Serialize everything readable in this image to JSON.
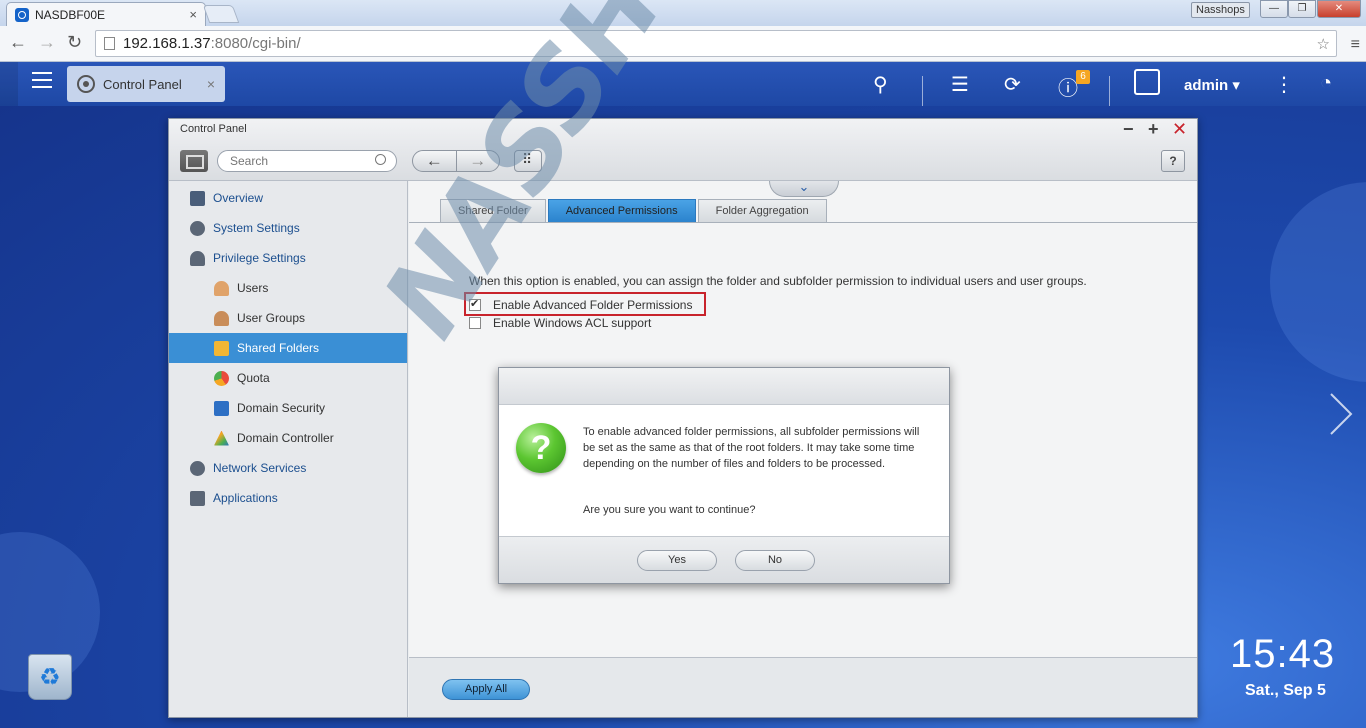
{
  "browser": {
    "tab_title": "NASDBF00E",
    "tab_close": "×",
    "profile": "Nasshops",
    "url_host": "192.168.1.37",
    "url_rest": ":8080/cgi-bin/",
    "win_min": "—",
    "win_max": "❐",
    "win_close": "✕"
  },
  "topbar": {
    "app_chip_label": "Control Panel",
    "app_chip_close": "×",
    "notification_count": "6",
    "username": "admin ▾"
  },
  "window": {
    "title": "Control Panel",
    "search_placeholder": "Search",
    "help_label": "?",
    "min": "−",
    "max": "+",
    "close": "✕"
  },
  "sidebar": {
    "items": [
      {
        "label": "Overview",
        "level": 1,
        "icon": "overview-icon"
      },
      {
        "label": "System Settings",
        "level": 1,
        "icon": "gear-icon"
      },
      {
        "label": "Privilege Settings",
        "level": 1,
        "icon": "user-icon"
      },
      {
        "label": "Users",
        "level": 2,
        "icon": "user-icon"
      },
      {
        "label": "User Groups",
        "level": 2,
        "icon": "group-icon"
      },
      {
        "label": "Shared Folders",
        "level": 2,
        "icon": "shared-folder-icon",
        "active": true
      },
      {
        "label": "Quota",
        "level": 2,
        "icon": "quota-icon"
      },
      {
        "label": "Domain Security",
        "level": 2,
        "icon": "domain-security-icon"
      },
      {
        "label": "Domain Controller",
        "level": 2,
        "icon": "domain-controller-icon"
      },
      {
        "label": "Network Services",
        "level": 1,
        "icon": "network-icon"
      },
      {
        "label": "Applications",
        "level": 1,
        "icon": "applications-icon"
      }
    ]
  },
  "tabs": [
    {
      "label": "Shared Folder",
      "active": false
    },
    {
      "label": "Advanced Permissions",
      "active": true
    },
    {
      "label": "Folder Aggregation",
      "active": false
    }
  ],
  "content": {
    "description": "When this option is enabled, you can assign the folder and subfolder permission to individual users and user groups.",
    "option_advanced": "Enable Advanced Folder Permissions",
    "option_acl": "Enable Windows ACL support",
    "apply_all": "Apply All"
  },
  "dialog": {
    "message": "To enable advanced folder permissions, all subfolder permissions will be set as the same as that of the root folders. It may take some time depending on the number of files and folders to be processed.",
    "question": "Are you sure you want to continue?",
    "yes": "Yes",
    "no": "No",
    "icon_glyph": "?"
  },
  "desktop": {
    "time": "15:43",
    "date": "Sat., Sep 5"
  },
  "watermark": "NASSHOPS.net",
  "colors": {
    "accent": "#3a8fd5",
    "highlight": "#c8232c",
    "badge": "#f5a623"
  }
}
